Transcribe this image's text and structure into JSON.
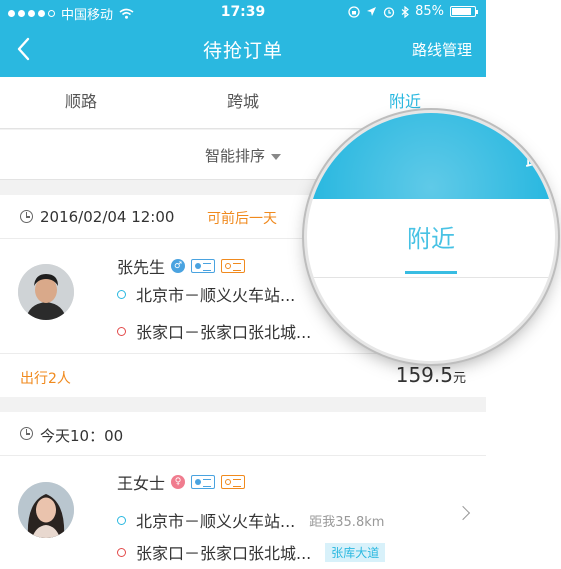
{
  "status": {
    "carrier": "中国移动",
    "time": "17:39",
    "battery": "85%",
    "battery_level": 0.85,
    "signal_bars_filled": 4
  },
  "nav": {
    "back_icon": "chevron-left-icon",
    "title": "待抢订单",
    "action": "路线管理"
  },
  "tabs": [
    {
      "label": "顺路",
      "active": false
    },
    {
      "label": "跨城",
      "active": false
    },
    {
      "label": "附近",
      "active": true
    }
  ],
  "sort": {
    "label": "智能排序"
  },
  "orders": [
    {
      "date": "2016/02/04   12:00",
      "flexible": "可前后一天",
      "name": "张先生",
      "gender": "male",
      "from": "北京市－顺义火车站...",
      "to": "张家口－张家口张北城...",
      "passengers": "出行2人",
      "price": "159.5",
      "price_unit": "元"
    },
    {
      "date": "今天10：00",
      "name": "王女士",
      "gender": "female",
      "from": "北京市－顺义火车站...",
      "distance": "距我35.8km",
      "to": "张家口－张家口张北城...",
      "tag": "张库大道"
    }
  ],
  "lens": {
    "top_text": "路",
    "tab": "附近"
  },
  "colors": {
    "accent": "#2ab8e0",
    "orange": "#f08a1e",
    "red": "#e24a4a"
  }
}
